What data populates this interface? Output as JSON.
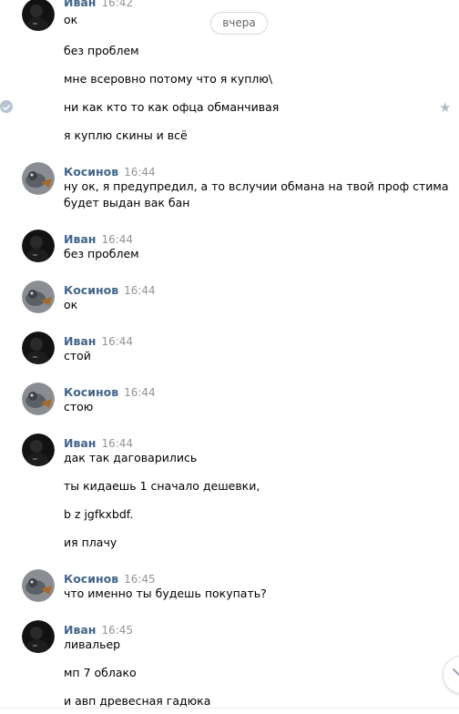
{
  "date_divider": "вчера",
  "colors": {
    "author": "#42648b",
    "time": "#939393",
    "text": "#000000"
  },
  "blocks": [
    {
      "author": "Иван",
      "time": "16:42",
      "avatar": "dark-avatar",
      "lines": [
        "ок",
        "без проблем",
        "мне всеровно потому что я куплю\\",
        "ни как кто то как офца обманчивая",
        "я куплю скины и всё"
      ]
    },
    {
      "author": "Косинов",
      "time": "16:44",
      "avatar": "bird-avatar",
      "lines": [
        "ну ок, я предупредил, а то вслучии обмана на твой проф стима",
        "будет выдан вак бан"
      ]
    },
    {
      "author": "Иван",
      "time": "16:44",
      "avatar": "dark-avatar",
      "lines": [
        "без проблем"
      ]
    },
    {
      "author": "Косинов",
      "time": "16:44",
      "avatar": "bird-avatar",
      "lines": [
        "ок"
      ]
    },
    {
      "author": "Иван",
      "time": "16:44",
      "avatar": "dark-avatar",
      "lines": [
        "стой"
      ]
    },
    {
      "author": "Косинов",
      "time": "16:44",
      "avatar": "bird-avatar",
      "lines": [
        "стою"
      ]
    },
    {
      "author": "Иван",
      "time": "16:44",
      "avatar": "dark-avatar",
      "lines": [
        "дак так даговарились",
        "ты кидаешь 1 сначало дешевки,",
        "b z jgfkxbdf.",
        "ия плачу"
      ]
    },
    {
      "author": "Косинов",
      "time": "16:45",
      "avatar": "bird-avatar",
      "lines": [
        "что именно ты будешь покупать?"
      ]
    },
    {
      "author": "Иван",
      "time": "16:45",
      "avatar": "dark-avatar",
      "lines": [
        "ливальер",
        "мп 7 облако",
        "и авп древесная гадюка"
      ]
    }
  ]
}
